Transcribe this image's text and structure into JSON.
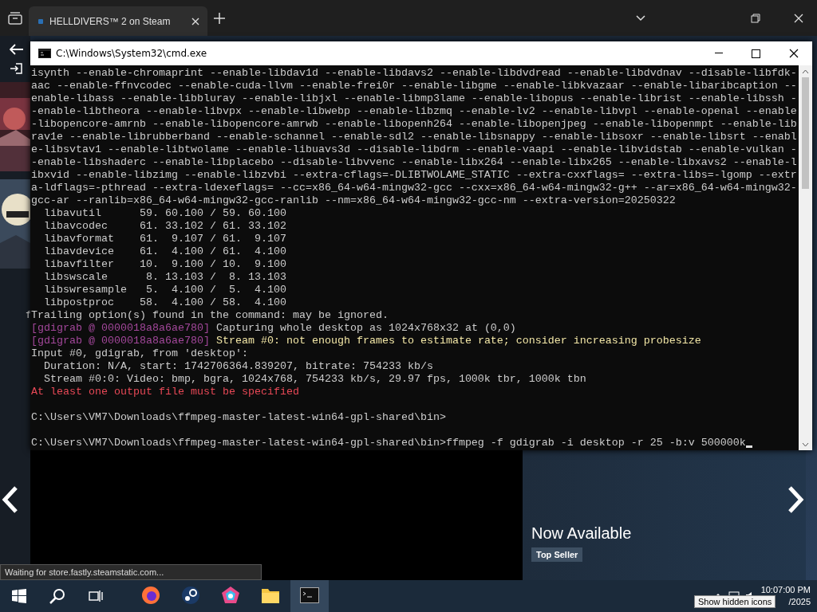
{
  "browser": {
    "tabs": [
      {
        "title": "HELLDIVERS™ 2 on Steam",
        "selected": true
      }
    ]
  },
  "console_window": {
    "title": "C:\\Windows\\System32\\cmd.exe",
    "lines": [
      {
        "segments": [
          {
            "text": "isynth --enable-chromaprint --enable-libdav1d --enable-libdavs2 --enable-libdvdread --enable-libdvdnav --disable-libfdk-",
            "kind": "normal"
          }
        ]
      },
      {
        "segments": [
          {
            "text": "aac --enable-ffnvcodec --enable-cuda-llvm --enable-frei0r --enable-libgme --enable-libkvazaar --enable-libaribcaption --",
            "kind": "normal"
          }
        ]
      },
      {
        "segments": [
          {
            "text": "enable-libass --enable-libbluray --enable-libjxl --enable-libmp3lame --enable-libopus --enable-librist --enable-libssh -",
            "kind": "normal"
          }
        ]
      },
      {
        "segments": [
          {
            "text": "-enable-libtheora --enable-libvpx --enable-libwebp --enable-libzmq --enable-lv2 --enable-libvpl --enable-openal --enable",
            "kind": "normal"
          }
        ]
      },
      {
        "segments": [
          {
            "text": "-libopencore-amrnb --enable-libopencore-amrwb --enable-libopenh264 --enable-libopenjpeg --enable-libopenmpt --enable-lib",
            "kind": "normal"
          }
        ]
      },
      {
        "segments": [
          {
            "text": "rav1e --enable-librubberband --enable-schannel --enable-sdl2 --enable-libsnappy --enable-libsoxr --enable-libsrt --enabl",
            "kind": "normal"
          }
        ]
      },
      {
        "segments": [
          {
            "text": "e-libsvtav1 --enable-libtwolame --enable-libuavs3d --disable-libdrm --enable-vaapi --enable-libvidstab --enable-vulkan -",
            "kind": "normal"
          }
        ]
      },
      {
        "segments": [
          {
            "text": "-enable-libshaderc --enable-libplacebo --disable-libvvenc --enable-libx264 --enable-libx265 --enable-libxavs2 --enable-l",
            "kind": "normal"
          }
        ]
      },
      {
        "segments": [
          {
            "text": "ibxvid --enable-libzimg --enable-libzvbi --extra-cflags=-DLIBTWOLAME_STATIC --extra-cxxflags= --extra-libs=-lgomp --extr",
            "kind": "normal"
          }
        ]
      },
      {
        "segments": [
          {
            "text": "a-ldflags=-pthread --extra-ldexeflags= --cc=x86_64-w64-mingw32-gcc --cxx=x86_64-w64-mingw32-g++ --ar=x86_64-w64-mingw32-",
            "kind": "normal"
          }
        ]
      },
      {
        "segments": [
          {
            "text": "gcc-ar --ranlib=x86_64-w64-mingw32-gcc-ranlib --nm=x86_64-w64-mingw32-gcc-nm --extra-version=20250322",
            "kind": "normal"
          }
        ]
      },
      {
        "segments": [
          {
            "text": "  libavutil      59. 60.100 / 59. 60.100",
            "kind": "normal"
          }
        ]
      },
      {
        "segments": [
          {
            "text": "  libavcodec     61. 33.102 / 61. 33.102",
            "kind": "normal"
          }
        ]
      },
      {
        "segments": [
          {
            "text": "  libavformat    61.  9.107 / 61.  9.107",
            "kind": "normal"
          }
        ]
      },
      {
        "segments": [
          {
            "text": "  libavdevice    61.  4.100 / 61.  4.100",
            "kind": "normal"
          }
        ]
      },
      {
        "segments": [
          {
            "text": "  libavfilter    10.  9.100 / 10.  9.100",
            "kind": "normal"
          }
        ]
      },
      {
        "segments": [
          {
            "text": "  libswscale      8. 13.103 /  8. 13.103",
            "kind": "normal"
          }
        ]
      },
      {
        "segments": [
          {
            "text": "  libswresample   5.  4.100 /  5.  4.100",
            "kind": "normal"
          }
        ]
      },
      {
        "segments": [
          {
            "text": "  libpostproc    58.  4.100 / 58.  4.100",
            "kind": "normal"
          }
        ]
      },
      {
        "segments": [
          {
            "text": "Trailing option(s) found in the command: may be ignored.",
            "kind": "normal"
          }
        ]
      },
      {
        "segments": [
          {
            "text": "[gdigrab @ 0000018a8a6ae780]",
            "kind": "tag"
          },
          {
            "text": " Capturing whole desktop as 1024x768x32 at (0,0)",
            "kind": "normal"
          }
        ]
      },
      {
        "segments": [
          {
            "text": "[gdigrab @ 0000018a8a6ae780]",
            "kind": "tag"
          },
          {
            "text": " Stream #0: not enough frames to estimate rate; consider increasing probesize",
            "kind": "warning"
          }
        ]
      },
      {
        "segments": [
          {
            "text": "Input #0, gdigrab, from 'desktop':",
            "kind": "normal"
          }
        ]
      },
      {
        "segments": [
          {
            "text": "  Duration: N/A, start: 1742706364.839207, bitrate: 754233 kb/s",
            "kind": "normal"
          }
        ]
      },
      {
        "segments": [
          {
            "text": "  Stream #0:0: Video: bmp, bgra, 1024x768, 754233 kb/s, 29.97 fps, 1000k tbr, 1000k tbn",
            "kind": "normal"
          }
        ]
      },
      {
        "segments": [
          {
            "text": "At least one output file must be specified",
            "kind": "error"
          }
        ]
      },
      {
        "gap_before": true,
        "segments": [
          {
            "text": "C:\\Users\\VM7\\Downloads\\ffmpeg-master-latest-win64-gpl-shared\\bin>",
            "kind": "normal"
          }
        ]
      },
      {
        "gap_before": true,
        "cursor": true,
        "segments": [
          {
            "text": "C:\\Users\\VM7\\Downloads\\ffmpeg-master-latest-win64-gpl-shared\\bin>ffmpeg -f gdigrab -i desktop -r 25 -b:v 500000k",
            "kind": "normal"
          }
        ]
      }
    ]
  },
  "page": {
    "fragment": "f",
    "headline": "Now Available",
    "tag": "Top Seller"
  },
  "status_bubble": "Waiting for store.fastly.steamstatic.com...",
  "taskbar": {
    "apps": [
      {
        "kind": "firefox",
        "selected": false
      },
      {
        "kind": "steam",
        "selected": false
      },
      {
        "kind": "pentagon",
        "selected": false
      },
      {
        "kind": "folder",
        "selected": false
      },
      {
        "kind": "terminal",
        "selected": true
      }
    ],
    "time": "10:07:00 PM",
    "date": "/2025",
    "tooltip": "Show hidden icons"
  }
}
